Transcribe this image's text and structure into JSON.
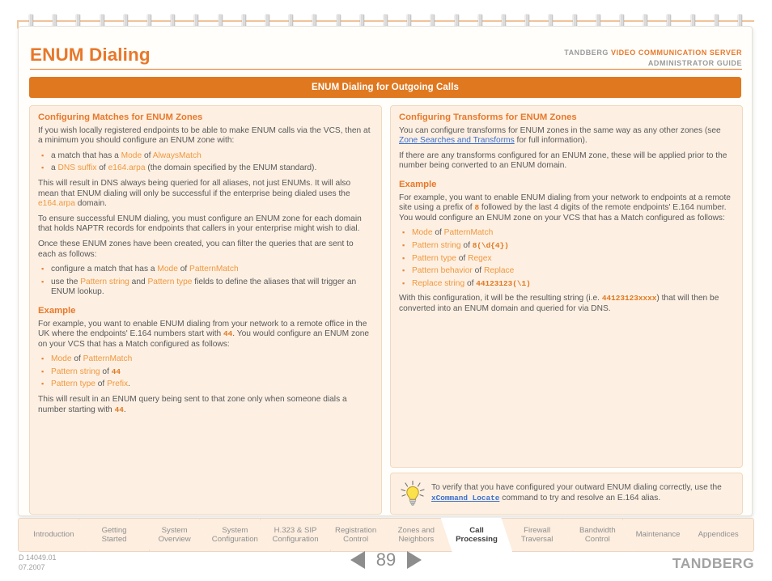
{
  "header": {
    "doc_title": "ENUM Dialing",
    "brand_prefix": "TANDBERG",
    "brand_product": "VIDEO COMMUNICATION SERVER",
    "brand_subtitle": "ADMINISTRATOR GUIDE"
  },
  "banner": {
    "title": "ENUM Dialing for Outgoing Calls"
  },
  "left_panel": {
    "heading": "Configuring Matches for ENUM Zones",
    "para1": "If you wish locally registered endpoints to be able to make ENUM calls via the VCS, then at a minimum you should configure an ENUM zone with:",
    "bullets1": [
      {
        "pre": "a match that has a ",
        "kw1": "Mode",
        "mid": " of ",
        "kw2": "AlwaysMatch",
        "post": ""
      },
      {
        "pre": "a ",
        "kw1": "DNS suffix",
        "mid": " of ",
        "kw2": "e164.arpa",
        "post": " (the domain specified by the ENUM standard)."
      }
    ],
    "para2_a": "This will result in DNS always being queried for all aliases, not just ENUMs.  It will also mean that ENUM dialing will only be successful if the enterprise being dialed uses the ",
    "para2_kw": "e164.arpa",
    "para2_b": " domain.",
    "para3": "To ensure successful ENUM dialing, you must configure an ENUM zone for each domain that holds NAPTR records for endpoints that callers in your enterprise might wish to dial.",
    "para4": "Once these ENUM zones have been created, you can filter the queries that are sent to each as follows:",
    "bullets2": [
      {
        "pre": "configure a match that has a ",
        "kw1": "Mode",
        "mid": " of ",
        "kw2": "PatternMatch",
        "post": ""
      },
      {
        "pre": "use the ",
        "kw1": "Pattern string",
        "mid": " and ",
        "kw2": "Pattern type",
        "post": " fields to define the aliases that will trigger an ENUM lookup."
      }
    ],
    "example_heading": "Example",
    "example_para_a": "For example, you want to enable ENUM dialing from your network to a remote office in the UK where the endpoints' E.164 numbers start with ",
    "example_para_code": "44",
    "example_para_b": ".  You would configure an ENUM zone on your VCS that has a Match configured as follows:",
    "example_bullets": [
      {
        "kw": "Mode",
        "mid": " of ",
        "value": "PatternMatch",
        "value_style": "kw",
        "post": ""
      },
      {
        "kw": "Pattern string",
        "mid": " of ",
        "value": "44",
        "value_style": "mono",
        "post": ""
      },
      {
        "kw": "Pattern type",
        "mid": " of ",
        "value": "Prefix",
        "value_style": "kw",
        "post": "."
      }
    ],
    "closing_a": "This will result in an ENUM query being sent to that zone only when someone dials a number starting with ",
    "closing_code": "44",
    "closing_b": "."
  },
  "right_panel": {
    "heading": "Configuring Transforms for ENUM Zones",
    "para1_a": "You can configure transforms for ENUM zones in the same way as any other zones (see ",
    "para1_link": "Zone Searches and Transforms",
    "para1_b": " for full information).",
    "para2": "If there are any transforms configured for an ENUM zone, these will be applied prior to the number being converted to an ENUM domain.",
    "example_heading": "Example",
    "example_para_a": "For example, you want to enable ENUM dialing from your network to endpoints at a remote site using a prefix of ",
    "example_para_code": "8",
    "example_para_b": " followed by the last 4 digits of the remote endpoints' E.164 number.   You would configure an ENUM zone on your VCS that has a Match configured as follows:",
    "example_bullets": [
      {
        "kw": "Mode",
        "mid": " of ",
        "value": "PatternMatch",
        "value_style": "kw"
      },
      {
        "kw": "Pattern string",
        "mid": " of ",
        "value": "8(\\d{4})",
        "value_style": "mono"
      },
      {
        "kw": "Pattern type",
        "mid": " of ",
        "value": "Regex",
        "value_style": "kw"
      },
      {
        "kw": "Pattern behavior",
        "mid": " of ",
        "value": "Replace",
        "value_style": "kw"
      },
      {
        "kw": "Replace string",
        "mid": " of ",
        "value": "44123123(\\1)",
        "value_style": "mono"
      }
    ],
    "closing_a": "With this configuration, it will be the resulting string (i.e. ",
    "closing_code": "44123123xxxx",
    "closing_b": ") that will then be converted into an ENUM domain and queried for via DNS."
  },
  "tip": {
    "icon": "lightbulb-icon",
    "text_a": "To verify that you have configured your outward ENUM dialing correctly, use the ",
    "link": "xCommand Locate",
    "text_b": " command to try and resolve an E.164 alias."
  },
  "tabs": [
    {
      "label": "Introduction",
      "active": false
    },
    {
      "label": "Getting\nStarted",
      "active": false
    },
    {
      "label": "System\nOverview",
      "active": false
    },
    {
      "label": "System\nConfiguration",
      "active": false
    },
    {
      "label": "H.323 & SIP\nConfiguration",
      "active": false
    },
    {
      "label": "Registration\nControl",
      "active": false
    },
    {
      "label": "Zones and\nNeighbors",
      "active": false
    },
    {
      "label": "Call\nProcessing",
      "active": true
    },
    {
      "label": "Firewall\nTraversal",
      "active": false
    },
    {
      "label": "Bandwidth\nControl",
      "active": false
    },
    {
      "label": "Maintenance",
      "active": false
    },
    {
      "label": "Appendices",
      "active": false
    }
  ],
  "footer": {
    "doc_number": "D 14049.01",
    "doc_date": "07.2007",
    "page_number": "89",
    "prev_icon": "triangle-left-icon",
    "next_icon": "triangle-right-icon",
    "logo": "TANDBERG"
  },
  "colors": {
    "accent_orange": "#e8782a",
    "banner_orange": "#e07820",
    "panel_bg": "#fdf0e2",
    "panel_border": "#f0d9c0",
    "keyword": "#f0973f",
    "link": "#3b6fcd",
    "footer_grey": "#a0a0a0"
  }
}
